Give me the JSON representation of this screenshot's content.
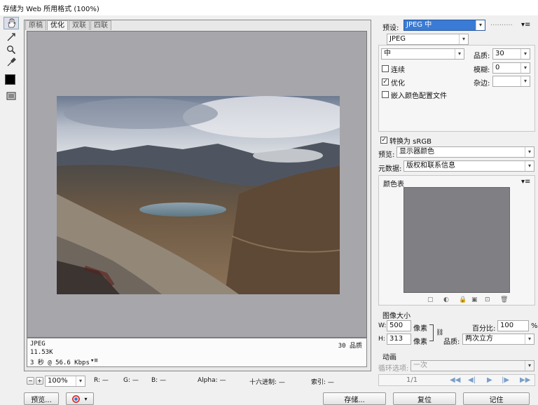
{
  "window": {
    "title": "存储为 Web 所用格式 (100%)"
  },
  "tools": [
    {
      "name": "hand-tool-icon",
      "glyph": "✋",
      "selected": true
    },
    {
      "name": "slice-select-icon",
      "glyph": "↗"
    },
    {
      "name": "zoom-icon",
      "glyph": "🔍"
    },
    {
      "name": "eyedropper-icon",
      "glyph": "✎"
    }
  ],
  "tabs": [
    "原稿",
    "优化",
    "双联",
    "四联"
  ],
  "active_tab": 1,
  "info": {
    "format": "JPEG",
    "size": "11.53K",
    "time": "3 秒 @ 56.6 Kbps",
    "time_menu": "▾≡",
    "quality": "30 品质"
  },
  "status": {
    "zoom": "100%",
    "r": "R: —",
    "g": "G: —",
    "b": "B: —",
    "alpha": "Alpha: —",
    "hex": "十六进制: —",
    "index": "索引: —"
  },
  "right": {
    "preset_label": "预设:",
    "preset_value": "JPEG 中",
    "format_value": "JPEG",
    "quality_preset": "中",
    "quality_label": "品质:",
    "quality_value": "30",
    "blur_label": "模糊:",
    "blur_value": "0",
    "matte_label": "杂边:",
    "progressive": "连续",
    "optimized": "优化",
    "embed_profile": "嵌入颜色配置文件",
    "convert_srgb": "转换为 sRGB",
    "preview_label": "预览:",
    "preview_value": "显示器颜色",
    "metadata_label": "元数据:",
    "metadata_value": "版权和联系信息",
    "color_table": "颜色表",
    "image_size": "图像大小",
    "w_label": "W:",
    "w_value": "500",
    "h_label": "H:",
    "h_value": "313",
    "px": "像素",
    "percent_label": "百分比:",
    "percent_value": "100",
    "percent_unit": "%",
    "quality2_label": "品质:",
    "resample_value": "两次立方",
    "animation": "动画",
    "loop_label": "循环选项:",
    "loop_value": "一次",
    "frame_counter": "1/1"
  },
  "buttons": {
    "preview": "预览...",
    "save": "存储...",
    "reset": "复位",
    "remember": "记住"
  },
  "colors": {
    "preset_highlight": "#3a7bd5",
    "canvas": "#a7a6ab",
    "color_table_bg": "#807f84"
  }
}
